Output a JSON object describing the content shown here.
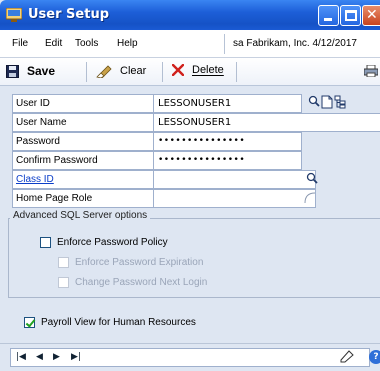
{
  "window": {
    "title": "User Setup"
  },
  "menu": {
    "file": "File",
    "edit": "Edit",
    "tools": "Tools",
    "help": "Help",
    "status": "sa  Fabrikam, Inc.  4/12/2017"
  },
  "toolbar": {
    "save_label": "Save",
    "clear_label": "Clear",
    "delete_label": "Delete"
  },
  "form": {
    "user_id_label": "User ID",
    "user_id_value": "LESSONUSER1",
    "user_name_label": "User Name",
    "user_name_value": "LESSONUSER1",
    "password_label": "Password",
    "password_value": "•••••••••••••••",
    "confirm_password_label": "Confirm Password",
    "confirm_password_value": "•••••••••••••••",
    "class_id_label": "Class ID",
    "class_id_value": "",
    "home_page_role_label": "Home Page Role",
    "home_page_role_value": ""
  },
  "advanced": {
    "group_title": "Advanced SQL Server options",
    "enforce_policy_label": "Enforce Password Policy",
    "enforce_policy_checked": false,
    "enforce_expiration_label": "Enforce Password Expiration",
    "enforce_expiration_checked": false,
    "change_next_login_label": "Change Password Next Login",
    "change_next_login_checked": false
  },
  "payroll": {
    "label": "Payroll View for Human Resources",
    "checked": true
  },
  "colors": {
    "link": "#0b3ec9",
    "window_bg": "#dee6f2",
    "titlebar": "#1d5fd8"
  }
}
